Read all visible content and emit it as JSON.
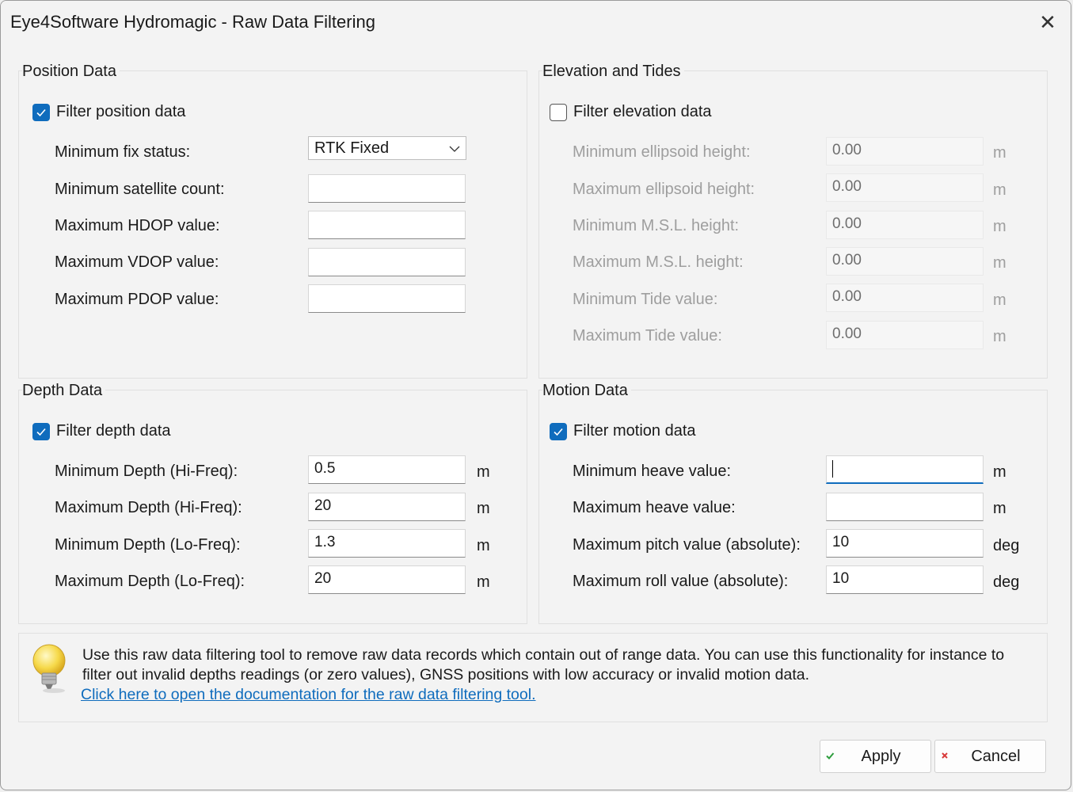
{
  "window": {
    "title": "Eye4Software Hydromagic - Raw Data Filtering",
    "close_glyph": "✕"
  },
  "position": {
    "title": "Position Data",
    "checkbox_label": "Filter position data",
    "checked": true,
    "fix_label": "Minimum fix status:",
    "fix_value": "RTK Fixed",
    "sat_label": "Minimum satellite count:",
    "sat_value": "",
    "hdop_label": "Maximum HDOP value:",
    "hdop_value": "",
    "vdop_label": "Maximum VDOP value:",
    "vdop_value": "",
    "pdop_label": "Maximum PDOP value:",
    "pdop_value": ""
  },
  "elevation": {
    "title": "Elevation and Tides",
    "checkbox_label": "Filter elevation data",
    "checked": false,
    "rows": [
      {
        "label": "Minimum ellipsoid height:",
        "value": "0.00",
        "unit": "m"
      },
      {
        "label": "Maximum ellipsoid height:",
        "value": "0.00",
        "unit": "m"
      },
      {
        "label": "Minimum M.S.L. height:",
        "value": "0.00",
        "unit": "m"
      },
      {
        "label": "Maximum M.S.L. height:",
        "value": "0.00",
        "unit": "m"
      },
      {
        "label": "Minimum Tide value:",
        "value": "0.00",
        "unit": "m"
      },
      {
        "label": "Maximum Tide value:",
        "value": "0.00",
        "unit": "m"
      }
    ]
  },
  "depth": {
    "title": "Depth Data",
    "checkbox_label": "Filter depth data",
    "checked": true,
    "rows": [
      {
        "label": "Minimum Depth (Hi-Freq):",
        "value": "0.5",
        "unit": "m"
      },
      {
        "label": "Maximum Depth (Hi-Freq):",
        "value": "20",
        "unit": "m"
      },
      {
        "label": "Minimum Depth (Lo-Freq):",
        "value": "1.3",
        "unit": "m"
      },
      {
        "label": "Maximum Depth (Lo-Freq):",
        "value": "20",
        "unit": "m"
      }
    ]
  },
  "motion": {
    "title": "Motion Data",
    "checkbox_label": "Filter motion data",
    "checked": true,
    "rows": [
      {
        "label": "Minimum heave value:",
        "value": "",
        "unit": "m"
      },
      {
        "label": "Maximum heave value:",
        "value": "",
        "unit": "m"
      },
      {
        "label": "Maximum pitch value (absolute):",
        "value": "10",
        "unit": "deg"
      },
      {
        "label": "Maximum roll value (absolute):",
        "value": "10",
        "unit": "deg"
      }
    ]
  },
  "info": {
    "text": "Use this raw data filtering tool to remove raw data records which contain out of range data. You can use this functionality for instance to filter out invalid depths readings (or zero values), GNSS positions with low accuracy or invalid motion data.",
    "link": "Click here to open the documentation for the raw data filtering tool."
  },
  "buttons": {
    "apply": "Apply",
    "cancel": "Cancel"
  },
  "colors": {
    "accent": "#0f6cbd",
    "apply_icon": "#2e9e3e",
    "cancel_icon": "#d83b3b",
    "disabled_text": "#9e9e9e"
  }
}
